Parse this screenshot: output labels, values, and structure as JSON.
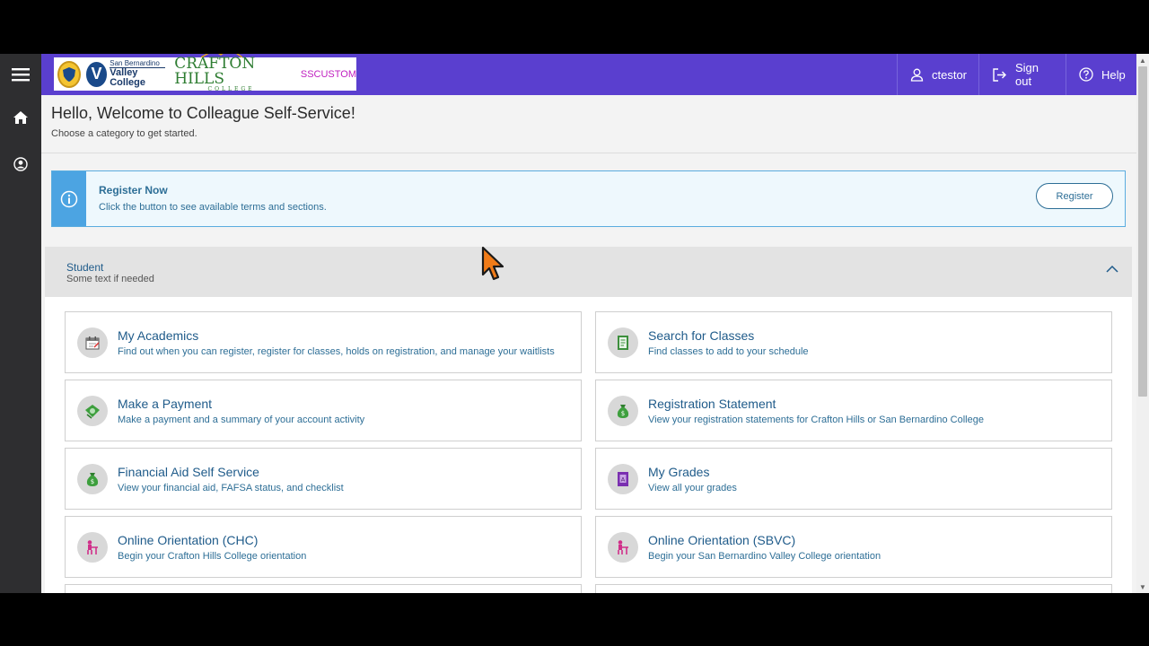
{
  "header": {
    "logo_sbvc_small": "San Bernardino",
    "logo_sbvc_big": "Valley College",
    "logo_vc_letter": "V",
    "logo_chc": "CRAFTON HILLS",
    "logo_chc_sub": "COLLEGE",
    "logo_tag": "SSCUSTOM",
    "user_name": "ctestor",
    "sign_out": "Sign out",
    "help": "Help"
  },
  "welcome": {
    "title": "Hello, Welcome to Colleague Self-Service!",
    "subtitle": "Choose a category to get started."
  },
  "alert": {
    "title": "Register Now",
    "message": "Click the button to see available terms and sections.",
    "button": "Register"
  },
  "student": {
    "title": "Student",
    "subtitle": "Some text if needed"
  },
  "cards": [
    {
      "title": "My Academics",
      "desc": "Find out when you can register, register for classes, holds on registration, and manage your waitlists",
      "icon": "calendar-icon"
    },
    {
      "title": "Search for Classes",
      "desc": "Find classes to add to your schedule",
      "icon": "notebook-icon"
    },
    {
      "title": "Make a Payment",
      "desc": "Make a payment and a summary of your account activity",
      "icon": "money-icon"
    },
    {
      "title": "Registration Statement",
      "desc": "View your registration statements for Crafton Hills or San Bernardino College",
      "icon": "money-bag-icon"
    },
    {
      "title": "Financial Aid Self Service",
      "desc": "View your financial aid, FAFSA status, and checklist",
      "icon": "money-bag-icon"
    },
    {
      "title": "My Grades",
      "desc": "View all your grades",
      "icon": "grade-book-icon"
    },
    {
      "title": "Online Orientation (CHC)",
      "desc": "Begin your Crafton Hills College orientation",
      "icon": "student-desk-icon"
    },
    {
      "title": "Online Orientation (SBVC)",
      "desc": "Begin your San Bernardino Valley College orientation",
      "icon": "student-desk-icon"
    }
  ],
  "colors": {
    "topbar": "#5a3fcf",
    "nav": "#2e2e30",
    "accent": "#4ca4e2",
    "link": "#1f5b8a"
  }
}
